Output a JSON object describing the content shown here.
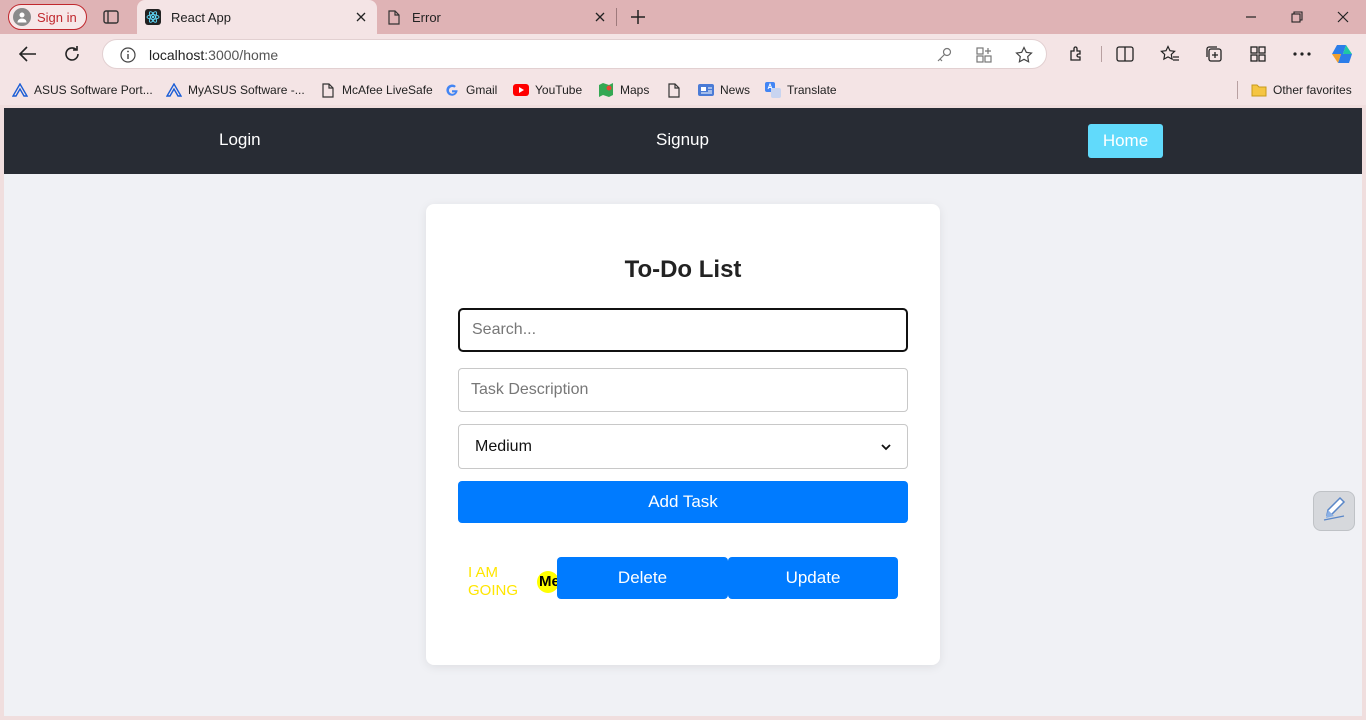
{
  "browser": {
    "profile_label": "Sign in",
    "tabs": [
      {
        "title": "React App",
        "active": true,
        "icon": "react-icon"
      },
      {
        "title": "Error",
        "active": false,
        "icon": "page-icon"
      }
    ],
    "url_host": "localhost",
    "url_path": ":3000/home",
    "favorites": [
      {
        "label": "ASUS Software Port...",
        "icon": "asus-icon"
      },
      {
        "label": "MyASUS Software -...",
        "icon": "asus-icon"
      },
      {
        "label": "McAfee LiveSafe",
        "icon": "page-icon"
      },
      {
        "label": "Gmail",
        "icon": "google-icon"
      },
      {
        "label": "YouTube",
        "icon": "youtube-icon"
      },
      {
        "label": "Maps",
        "icon": "maps-icon"
      },
      {
        "label": "",
        "icon": "page-icon"
      },
      {
        "label": "News",
        "icon": "news-icon"
      },
      {
        "label": "Translate",
        "icon": "translate-icon"
      }
    ],
    "other_favorites": "Other favorites"
  },
  "nav": {
    "login": "Login",
    "signup": "Signup",
    "home": "Home"
  },
  "todo": {
    "title": "To-Do List",
    "search_placeholder": "Search...",
    "description_placeholder": "Task Description",
    "priority_selected": "Medium",
    "add_button": "Add Task",
    "tasks": [
      {
        "text": "I AM GOING",
        "priority": "Me",
        "delete_label": "Delete",
        "update_label": "Update"
      }
    ]
  },
  "colors": {
    "navbar": "#282c34",
    "home_button": "#61dafb",
    "primary_button": "#007bff",
    "task_text": "#ffe600",
    "priority_badge": "#ffff00"
  }
}
